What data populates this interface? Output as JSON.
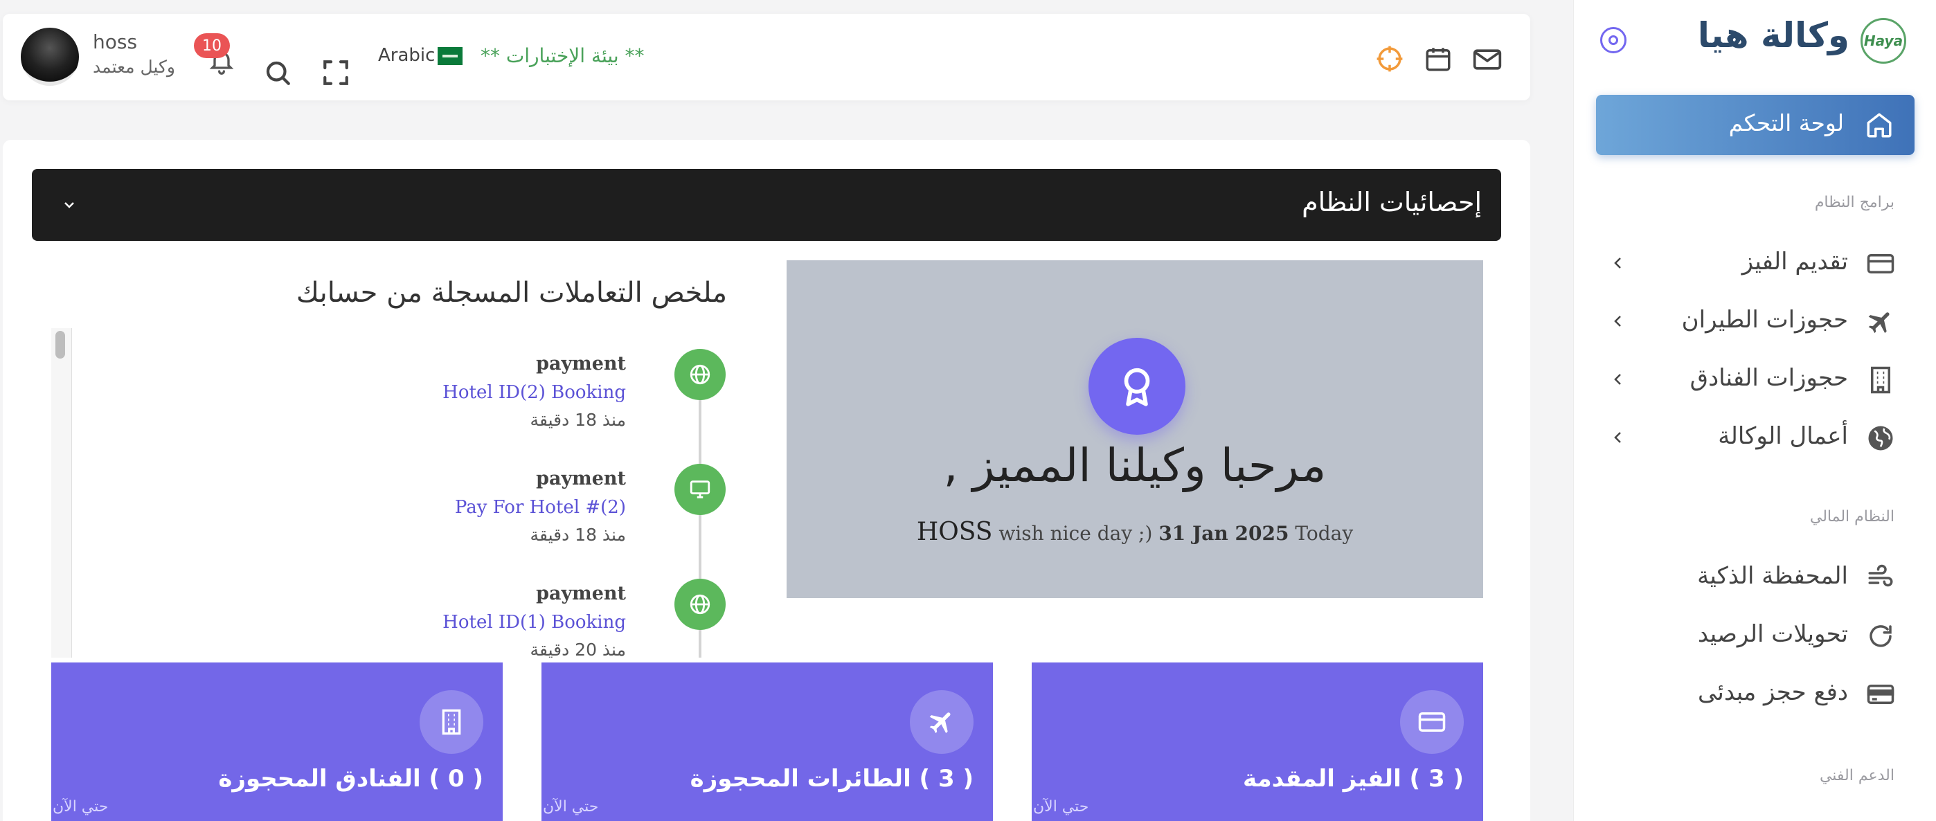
{
  "sidebar": {
    "brand_name": "وكالة هيا",
    "logo_text": "Haya",
    "active_item": "لوحة التحكم",
    "section_programs": "برامج النظام",
    "programs": [
      {
        "label": "تقديم الفيز",
        "icon": "credit-card-icon"
      },
      {
        "label": "حجوزات الطيران",
        "icon": "airplane-icon"
      },
      {
        "label": "حجوزات الفنادق",
        "icon": "building-icon"
      },
      {
        "label": "أعمال الوكالة",
        "icon": "globe-icon"
      }
    ],
    "section_finance": "النظام المالي",
    "finance": [
      {
        "label": "المحفظة الذكية",
        "icon": "wind-icon"
      },
      {
        "label": "تحويلات الرصيد",
        "icon": "refresh-icon"
      },
      {
        "label": "دفع حجز مبدئى",
        "icon": "card-icon"
      }
    ],
    "section_support": "الدعم الفني"
  },
  "topbar": {
    "user_name": "hoss",
    "user_role": "وكيل معتمد",
    "notifications_count": "10",
    "language": "Arabic",
    "environment": "** بيئة الإختبارات **"
  },
  "panel": {
    "title": "إحصائيات النظام"
  },
  "welcome": {
    "title": "مرحبا وكيلنا المميز ,",
    "user": "HOSS",
    "wish": "wish nice day ;)",
    "date": "31 Jan 2025",
    "today": "Today"
  },
  "transactions": {
    "title": "ملخص التعاملات المسجلة من حسابك",
    "items": [
      {
        "type": "payment",
        "description": "Hotel ID(2) Booking",
        "time": "منذ 18 دقيقة",
        "icon": "globe-icon"
      },
      {
        "type": "payment",
        "description": "Pay For Hotel #(2)",
        "time": "منذ 18 دقيقة",
        "icon": "monitor-icon"
      },
      {
        "type": "payment",
        "description": "Hotel ID(1) Booking",
        "time": "منذ 20 دقيقة",
        "icon": "globe-icon"
      }
    ]
  },
  "stats": [
    {
      "title": "( 0 ) الفنادق المحجوزة",
      "sub": "حتي الآن",
      "icon": "building-icon"
    },
    {
      "title": "( 3 ) الطائرات المحجوزة",
      "sub": "حتي الآن",
      "icon": "airplane-icon"
    },
    {
      "title": "( 3 ) الفيز المقدمة",
      "sub": "حتي الآن",
      "icon": "credit-card-icon"
    }
  ],
  "colors": {
    "accent": "#7367f0",
    "active_nav": "#4f86c6",
    "success": "#5cb85c",
    "environment": "#4aa25a",
    "badge": "#ea5455"
  }
}
